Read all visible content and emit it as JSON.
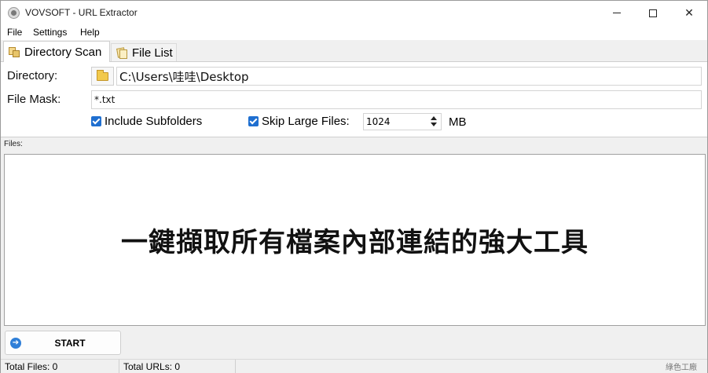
{
  "window": {
    "title": "VOVSOFT - URL Extractor",
    "minimize_glyph": "—",
    "close_glyph": "✕"
  },
  "menu": {
    "file": "File",
    "settings": "Settings",
    "help": "Help"
  },
  "tabs": [
    {
      "label": "Directory Scan",
      "active": true
    },
    {
      "label": "File List",
      "active": false
    }
  ],
  "form": {
    "directory_label": "Directory:",
    "directory_value": "C:\\Users\\哇哇\\Desktop",
    "file_mask_label": "File Mask:",
    "file_mask_value": "*.txt",
    "include_subfolders_label": "Include Subfolders",
    "include_subfolders_checked": true,
    "skip_large_files_label": "Skip Large Files:",
    "skip_large_files_checked": true,
    "size_value": "1024",
    "size_unit": "MB"
  },
  "files": {
    "label": "Files:",
    "overlay_text": "一鍵擷取所有檔案內部連結的強大工具"
  },
  "actions": {
    "start_label": "START",
    "start_icon": "➔"
  },
  "status": {
    "total_files": "Total Files: 0",
    "total_urls": "Total URLs: 0"
  },
  "watermark": "綠色工廠",
  "colors": {
    "accent": "#1f6fd0",
    "background": "#f0f0f0"
  }
}
